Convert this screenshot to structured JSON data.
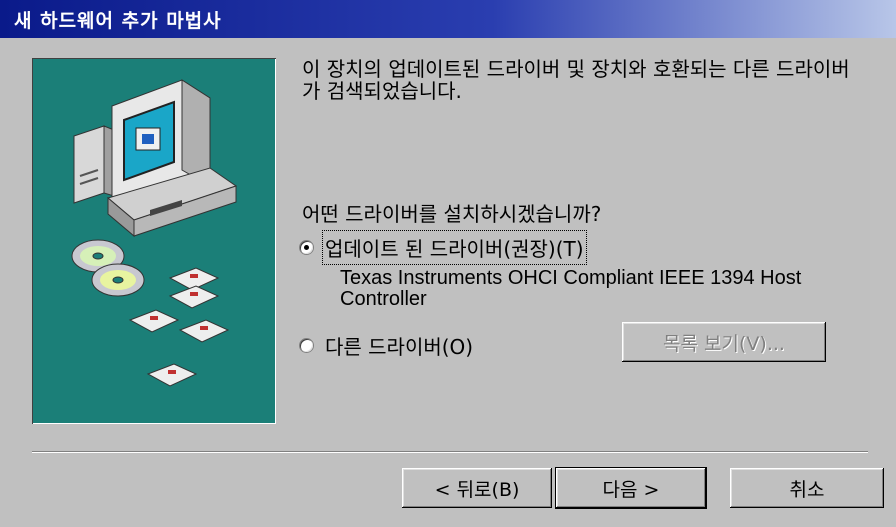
{
  "window": {
    "title": "새 하드웨어 추가 마법사"
  },
  "main": {
    "description": "이 장치의 업데이트된 드라이버 및 장치와 호환되는 다른 드라이버가 검색되었습니다.",
    "question": "어떤 드라이버를 설치하시겠습니까?",
    "option_updated": {
      "label": "업데이트 된 드라이버(권장)(T)",
      "selected": true
    },
    "updated_driver_name": "Texas Instruments OHCI Compliant IEEE 1394 Host Controller",
    "option_other": {
      "label": "다른 드라이버(O)",
      "selected": false
    },
    "list_button": "목록 보기(V)..."
  },
  "buttons": {
    "back": "< 뒤로(B)",
    "next": "다음 >",
    "cancel": "취소"
  },
  "colors": {
    "title_gradient_start": "#0a1a8a",
    "title_gradient_end": "#b8c6e8",
    "art_background": "#1b7f78",
    "dialog_background": "#c0c0c0"
  },
  "icons": [
    "computer-icon",
    "cd-disc-icon",
    "floppy-disk-icon"
  ]
}
